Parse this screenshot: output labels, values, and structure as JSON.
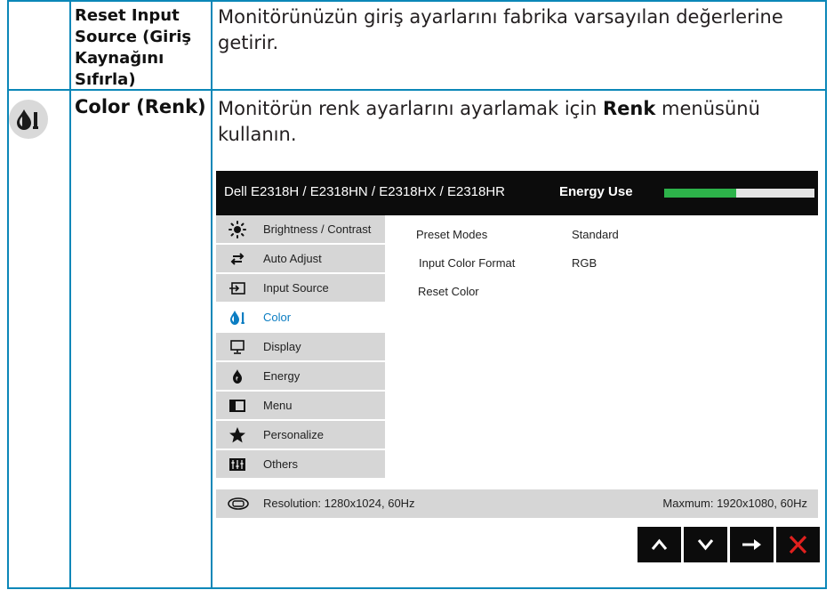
{
  "rows": [
    {
      "name_lines": [
        "Reset Input",
        "Source (Giriş",
        "Kaynağını",
        "Sıfırla)"
      ],
      "desc_lines": [
        "Monitörünüzün giriş ayarlarını fabrika varsayılan değerlerine",
        "getirir."
      ]
    },
    {
      "name": "Color (Renk)",
      "icon": "color-drop-icon",
      "desc_line1_before": "Monitörün renk ayarlarını ayarlamak için ",
      "desc_line1_bold": "Renk",
      "desc_line1_after": " menüsünü",
      "desc_line2": "kullanın."
    }
  ],
  "osd": {
    "model": "Dell E2318H / E2318HN / E2318HX / E2318HR",
    "energy_label": "Energy Use",
    "energy_level_fraction": 0.48,
    "colors": {
      "energy_fill": "#2db24a",
      "active_menu_text": "#0b7dc2",
      "header_bg": "#0c0c0c",
      "menu_bg": "#d6d6d6"
    },
    "menu": [
      {
        "label": "Brightness / Contrast",
        "icon": "brightness-icon",
        "active": false
      },
      {
        "label": "Auto Adjust",
        "icon": "auto-adjust-icon",
        "active": false
      },
      {
        "label": "Input Source",
        "icon": "input-source-icon",
        "active": false
      },
      {
        "label": "Color",
        "icon": "color-icon",
        "active": true
      },
      {
        "label": "Display",
        "icon": "display-icon",
        "active": false
      },
      {
        "label": "Energy",
        "icon": "energy-icon",
        "active": false
      },
      {
        "label": "Menu",
        "icon": "menu-icon",
        "active": false
      },
      {
        "label": "Personalize",
        "icon": "star-icon",
        "active": false
      },
      {
        "label": "Others",
        "icon": "others-icon",
        "active": false
      }
    ],
    "submenu": [
      {
        "label": "Preset Modes",
        "value": "Standard"
      },
      {
        "label": "Input Color Format",
        "value": "RGB"
      },
      {
        "label": "Reset Color",
        "value": ""
      }
    ],
    "footer": {
      "icon": "resolution-icon",
      "resolution": "Resolution: 1280x1024, 60Hz",
      "maximum": "Maxmum: 1920x1080, 60Hz"
    },
    "nav_buttons": [
      {
        "name": "up-button",
        "icon": "chevron-up-icon"
      },
      {
        "name": "down-button",
        "icon": "chevron-down-icon"
      },
      {
        "name": "enter-button",
        "icon": "arrow-right-icon"
      },
      {
        "name": "exit-button",
        "icon": "close-icon"
      }
    ]
  }
}
